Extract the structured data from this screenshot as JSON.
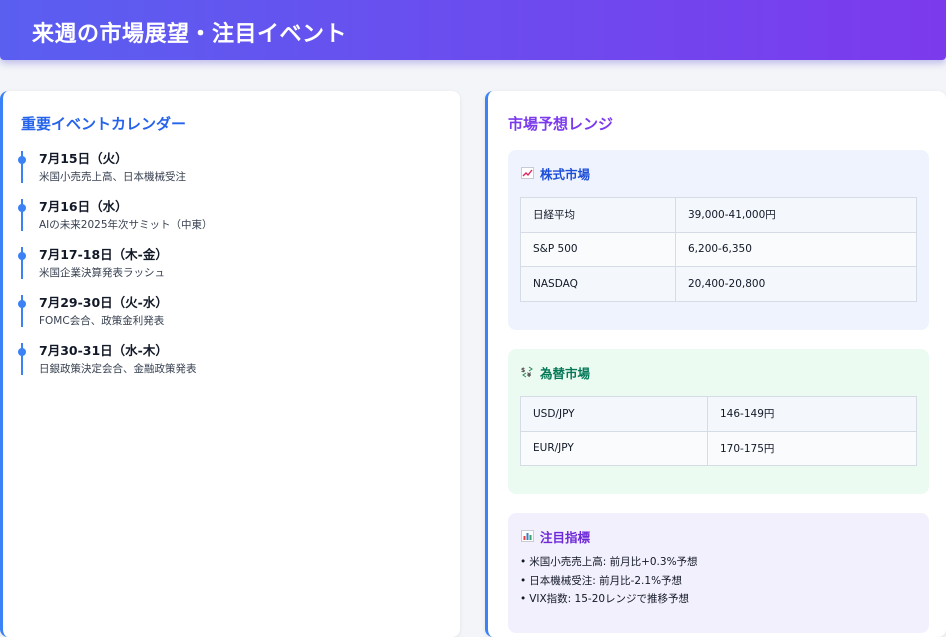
{
  "header": {
    "title": "来週の市場展望・注目イベント"
  },
  "calendar": {
    "title": "重要イベントカレンダー",
    "events": [
      {
        "date": "7月15日（火）",
        "desc": "米国小売売上高、日本機械受注"
      },
      {
        "date": "7月16日（水）",
        "desc": "AIの未来2025年次サミット（中東）"
      },
      {
        "date": "7月17-18日（木-金）",
        "desc": "米国企業決算発表ラッシュ"
      },
      {
        "date": "7月29-30日（火-水）",
        "desc": "FOMC会合、政策金利発表"
      },
      {
        "date": "7月30-31日（水-木）",
        "desc": "日銀政策決定会合、金融政策発表"
      }
    ]
  },
  "ranges": {
    "title": "市場予想レンジ",
    "stock": {
      "title": "株式市場",
      "icon": "chart-up-icon",
      "rows": [
        {
          "name": "日経平均",
          "range": "39,000-41,000円"
        },
        {
          "name": "S&P 500",
          "range": "6,200-6,350"
        },
        {
          "name": "NASDAQ",
          "range": "20,400-20,800"
        }
      ]
    },
    "fx": {
      "title": "為替市場",
      "icon": "currency-exchange-icon",
      "rows": [
        {
          "name": "USD/JPY",
          "range": "146-149円"
        },
        {
          "name": "EUR/JPY",
          "range": "170-175円"
        }
      ]
    },
    "indicators": {
      "title": "注目指標",
      "icon": "bar-chart-icon",
      "items": [
        "米国小売売上高: 前月比+0.3%予想",
        "日本機械受注: 前月比-2.1%予想",
        "VIX指数: 15-20レンジで推移予想"
      ]
    }
  },
  "colors": {
    "accent": "#3b82f6",
    "header_start": "#5a5ff0",
    "header_end": "#7c3aed"
  }
}
